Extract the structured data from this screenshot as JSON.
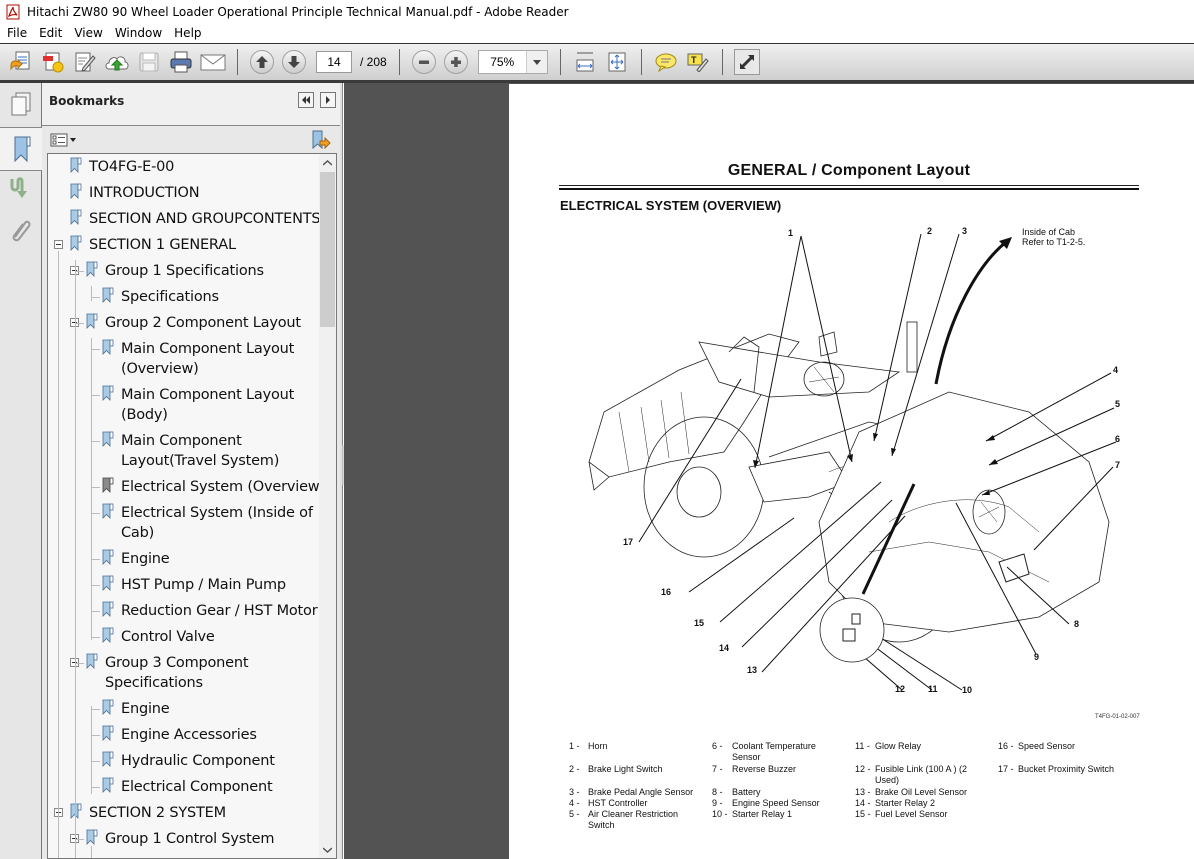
{
  "window": {
    "title": "Hitachi ZW80 90 Wheel Loader Operational Principle Technical Manual.pdf - Adobe Reader"
  },
  "menu": [
    "File",
    "Edit",
    "View",
    "Window",
    "Help"
  ],
  "toolbar": {
    "current_page": "14",
    "total_pages": "/ 208",
    "zoom_level": "75%",
    "icons": [
      "open-icon",
      "create-pdf-icon",
      "edit-icon",
      "upload-cloud-icon",
      "save-icon",
      "print-icon",
      "email-icon",
      "previous-page-icon",
      "next-page-icon",
      "zoom-out-icon",
      "zoom-in-icon",
      "fit-width-icon",
      "fit-page-icon",
      "comment-icon",
      "highlight-text-icon",
      "full-screen-icon"
    ]
  },
  "bookmarks": {
    "title": "Bookmarks",
    "items": [
      {
        "label": "TO4FG-E-00",
        "level": 0
      },
      {
        "label": "INTRODUCTION",
        "level": 0
      },
      {
        "label": "SECTION AND GROUPCONTENTS",
        "level": 0
      },
      {
        "label": "SECTION 1 GENERAL",
        "level": 0,
        "expanded": true
      },
      {
        "label": "Group 1 Specifications",
        "level": 1,
        "expanded": true
      },
      {
        "label": "Specifications",
        "level": 2
      },
      {
        "label": "Group 2 Component Layout",
        "level": 1,
        "expanded": true
      },
      {
        "label": "Main Component Layout",
        "label2": "(Overview)",
        "level": 2
      },
      {
        "label": "Main Component Layout",
        "label2": "(Body)",
        "level": 2
      },
      {
        "label": "Main Component",
        "label2": "Layout(Travel System)",
        "level": 2
      },
      {
        "label": "Electrical System (Overview)",
        "level": 2,
        "selected": true
      },
      {
        "label": "Electrical System (Inside of",
        "label2": "Cab)",
        "level": 2
      },
      {
        "label": "Engine",
        "level": 2
      },
      {
        "label": "HST Pump / Main Pump",
        "level": 2
      },
      {
        "label": "Reduction Gear / HST Motor",
        "level": 2
      },
      {
        "label": "Control Valve",
        "level": 2
      },
      {
        "label": "Group 3 Component",
        "label2": "Specifications",
        "level": 1,
        "expanded": true
      },
      {
        "label": "Engine",
        "level": 2
      },
      {
        "label": "Engine Accessories",
        "level": 2
      },
      {
        "label": "Hydraulic Component",
        "level": 2
      },
      {
        "label": "Electrical Component",
        "level": 2
      },
      {
        "label": "SECTION 2 SYSTEM",
        "level": 0,
        "expanded": true
      },
      {
        "label": "Group 1 Control System",
        "level": 1,
        "expanded": true
      }
    ]
  },
  "document": {
    "heading": "GENERAL / Component Layout",
    "subheading": "ELECTRICAL SYSTEM (OVERVIEW)",
    "cab_note_line1": "Inside of Cab",
    "cab_note_line2": "Refer to T1-2-5.",
    "figure_id": "T4FG-01-02-007",
    "callouts": [
      "1",
      "2",
      "3",
      "4",
      "5",
      "6",
      "7",
      "8",
      "9",
      "10",
      "11",
      "12",
      "13",
      "14",
      "15",
      "16",
      "17"
    ],
    "legend": [
      {
        "num": "1 -",
        "text": "Horn"
      },
      {
        "num": "2 -",
        "text": "Brake Light Switch"
      },
      {
        "num": "3 -",
        "text": "Brake Pedal Angle Sensor"
      },
      {
        "num": "4 -",
        "text": "HST Controller"
      },
      {
        "num": "5 -",
        "text": "Air Cleaner Restriction Switch"
      },
      {
        "num": "6 -",
        "text": "Coolant Temperature Sensor"
      },
      {
        "num": "7 -",
        "text": "Reverse Buzzer"
      },
      {
        "num": "8 -",
        "text": "Battery"
      },
      {
        "num": "9 -",
        "text": "Engine Speed Sensor"
      },
      {
        "num": "10 -",
        "text": "Starter Relay 1"
      },
      {
        "num": "11 -",
        "text": "Glow Relay"
      },
      {
        "num": "12 -",
        "text": "Fusible Link (100 A ) (2 Used)"
      },
      {
        "num": "13 -",
        "text": "Brake Oil Level Sensor"
      },
      {
        "num": "14 -",
        "text": "Starter Relay 2"
      },
      {
        "num": "15 -",
        "text": "Fuel Level Sensor"
      },
      {
        "num": "16 -",
        "text": "Speed Sensor"
      },
      {
        "num": "17 -",
        "text": "Bucket Proximity Switch"
      }
    ]
  }
}
